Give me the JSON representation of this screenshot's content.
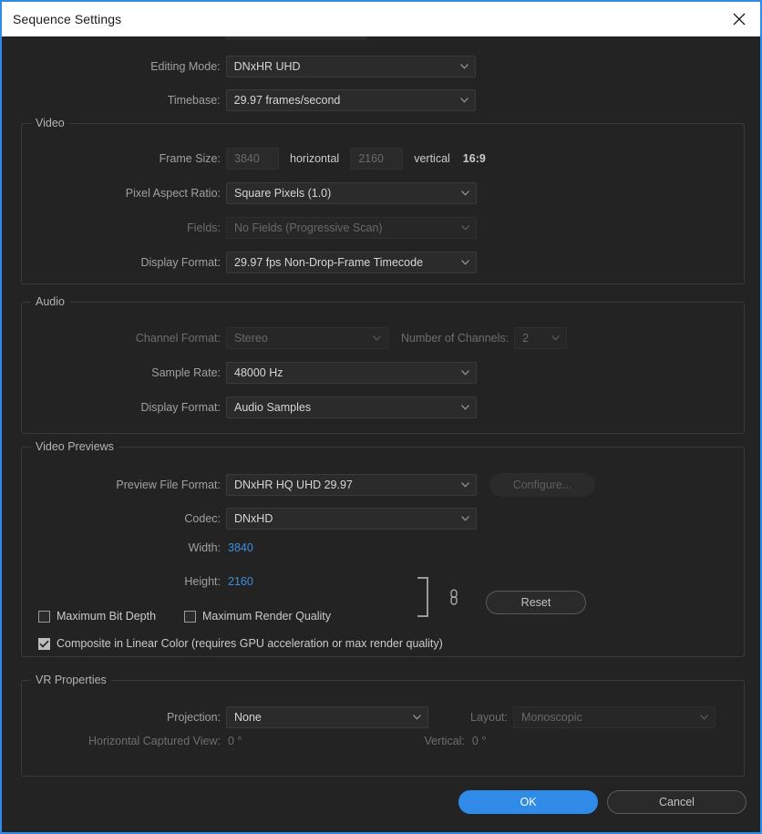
{
  "window": {
    "title": "Sequence Settings",
    "close_icon": "close-icon",
    "accent_color": "#2f8ae8",
    "titlebar_bg": "#ffffff",
    "body_bg": "#232323"
  },
  "top": {
    "editing_mode": {
      "label": "Editing Mode:",
      "value": "DNxHR UHD"
    },
    "timebase": {
      "label": "Timebase:",
      "value": "29.97  frames/second"
    }
  },
  "video": {
    "title": "Video",
    "frame_size": {
      "label": "Frame Size:",
      "horizontal_value": "3840",
      "horizontal_label": "horizontal",
      "vertical_value": "2160",
      "vertical_label": "vertical",
      "aspect": "16:9"
    },
    "pixel_aspect_ratio": {
      "label": "Pixel Aspect Ratio:",
      "value": "Square Pixels (1.0)"
    },
    "fields": {
      "label": "Fields:",
      "value": "No Fields (Progressive Scan)"
    },
    "display_format": {
      "label": "Display Format:",
      "value": "29.97 fps Non-Drop-Frame Timecode"
    }
  },
  "audio": {
    "title": "Audio",
    "channel_format": {
      "label": "Channel Format:",
      "value": "Stereo"
    },
    "number_of_channels": {
      "label": "Number of Channels:",
      "value": "2"
    },
    "sample_rate": {
      "label": "Sample Rate:",
      "value": "48000 Hz"
    },
    "display_format": {
      "label": "Display Format:",
      "value": "Audio Samples"
    }
  },
  "video_previews": {
    "title": "Video Previews",
    "preview_file_format": {
      "label": "Preview File Format:",
      "value": "DNxHR HQ UHD 29.97"
    },
    "configure_label": "Configure...",
    "codec": {
      "label": "Codec:",
      "value": "DNxHD"
    },
    "width": {
      "label": "Width:",
      "value": "3840",
      "color": "#3d8de0"
    },
    "height": {
      "label": "Height:",
      "value": "2160",
      "color": "#3d8de0"
    },
    "link_icon": "link-chain-icon",
    "reset_label": "Reset",
    "checkboxes": [
      {
        "label": "Maximum Bit Depth",
        "checked": false
      },
      {
        "label": "Maximum Render Quality",
        "checked": false
      },
      {
        "label": "Composite in Linear Color (requires GPU acceleration or max render quality)",
        "checked": true
      }
    ]
  },
  "vr_properties": {
    "title": "VR Properties",
    "projection": {
      "label": "Projection:",
      "value": "None"
    },
    "layout": {
      "label": "Layout:",
      "value": "Monoscopic"
    },
    "horizontal_captured_view": {
      "label": "Horizontal Captured View:",
      "value": "0 °"
    },
    "vertical": {
      "label": "Vertical:",
      "value": "0 °"
    }
  },
  "footer": {
    "ok_label": "OK",
    "cancel_label": "Cancel"
  }
}
